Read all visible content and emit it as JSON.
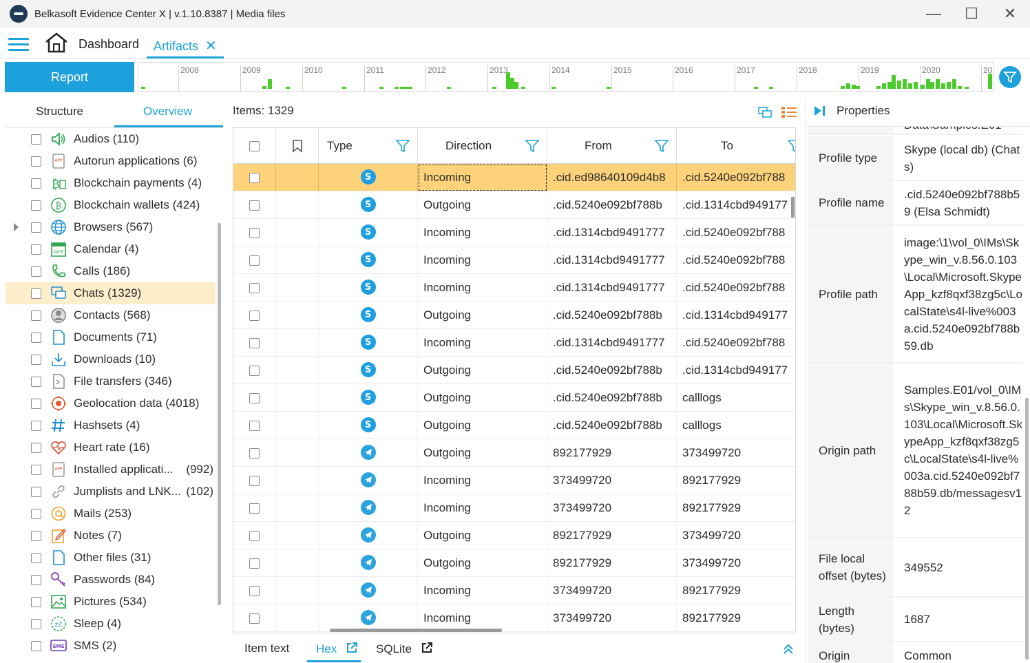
{
  "window": {
    "title": "Belkasoft Evidence Center X | v.1.10.8387 | Media files",
    "minimize": "—",
    "maximize": "☐",
    "close": "✕"
  },
  "menu": {
    "dashboard": "Dashboard",
    "artifacts": "Artifacts",
    "close_tab": "✕"
  },
  "toolbar": {
    "report": "Report"
  },
  "timeline": {
    "years": [
      "2008",
      "2009",
      "2010",
      "2011",
      "2012",
      "2013",
      "2014",
      "2015",
      "2016",
      "2017",
      "2018",
      "2019",
      "2020",
      "20"
    ]
  },
  "left_panel": {
    "tabs": [
      "Structure",
      "Overview"
    ],
    "active_tab": "Overview",
    "items": [
      {
        "label": "Audios (110)",
        "icon": "speaker-icon"
      },
      {
        "label": "Autorun applications (6)",
        "icon": "app-icon"
      },
      {
        "label": "Blockchain payments (4)",
        "icon": "bitcoin-payment-icon"
      },
      {
        "label": "Blockchain wallets (424)",
        "icon": "bitcoin-icon"
      },
      {
        "label": "Browsers (567)",
        "icon": "globe-icon"
      },
      {
        "label": "Calendar (4)",
        "icon": "calendar-icon"
      },
      {
        "label": "Calls (186)",
        "icon": "phone-icon"
      },
      {
        "label": "Chats (1329)",
        "icon": "chat-icon"
      },
      {
        "label": "Contacts (568)",
        "icon": "contact-icon"
      },
      {
        "label": "Documents (71)",
        "icon": "document-icon"
      },
      {
        "label": "Downloads (10)",
        "icon": "download-icon"
      },
      {
        "label": "File transfers (346)",
        "icon": "file-transfer-icon"
      },
      {
        "label": "Geolocation data (4018)",
        "icon": "geolocation-icon"
      },
      {
        "label": "Hashsets (4)",
        "icon": "hash-icon"
      },
      {
        "label": "Heart rate (16)",
        "icon": "heart-icon"
      },
      {
        "label": "Installed applicati...",
        "count": "(992)",
        "icon": "app-icon"
      },
      {
        "label": "Jumplists and LNK...",
        "count": "(102)",
        "icon": "link-icon"
      },
      {
        "label": "Mails (253)",
        "icon": "at-icon"
      },
      {
        "label": "Notes (7)",
        "icon": "note-icon"
      },
      {
        "label": "Other files (31)",
        "icon": "file-icon"
      },
      {
        "label": "Passwords (84)",
        "icon": "key-icon"
      },
      {
        "label": "Pictures (534)",
        "icon": "picture-icon"
      },
      {
        "label": "Sleep (4)",
        "icon": "sleep-icon"
      },
      {
        "label": "SMS (2)",
        "icon": "sms-icon"
      }
    ]
  },
  "center": {
    "items_label": "Items: 1329",
    "columns": [
      "Type",
      "Direction",
      "From",
      "To"
    ],
    "rows": [
      {
        "type": "skype",
        "direction": "Incoming",
        "from": ".cid.ed98640109d4b8",
        "to": ".cid.5240e092bf788"
      },
      {
        "type": "skype",
        "direction": "Outgoing",
        "from": ".cid.5240e092bf788b",
        "to": ".cid.1314cbd949177"
      },
      {
        "type": "skype",
        "direction": "Incoming",
        "from": ".cid.1314cbd9491777",
        "to": ".cid.5240e092bf788"
      },
      {
        "type": "skype",
        "direction": "Incoming",
        "from": ".cid.1314cbd9491777",
        "to": ".cid.5240e092bf788"
      },
      {
        "type": "skype",
        "direction": "Incoming",
        "from": ".cid.1314cbd9491777",
        "to": ".cid.5240e092bf788"
      },
      {
        "type": "skype",
        "direction": "Outgoing",
        "from": ".cid.5240e092bf788b",
        "to": ".cid.1314cbd949177"
      },
      {
        "type": "skype",
        "direction": "Incoming",
        "from": ".cid.1314cbd9491777",
        "to": ".cid.5240e092bf788"
      },
      {
        "type": "skype",
        "direction": "Outgoing",
        "from": ".cid.5240e092bf788b",
        "to": ".cid.1314cbd949177"
      },
      {
        "type": "skype",
        "direction": "Outgoing",
        "from": ".cid.5240e092bf788b",
        "to": "calllogs"
      },
      {
        "type": "skype",
        "direction": "Outgoing",
        "from": ".cid.5240e092bf788b",
        "to": "calllogs"
      },
      {
        "type": "telegram",
        "direction": "Outgoing",
        "from": "892177929",
        "to": "373499720"
      },
      {
        "type": "telegram",
        "direction": "Incoming",
        "from": "373499720",
        "to": "892177929"
      },
      {
        "type": "telegram",
        "direction": "Incoming",
        "from": "373499720",
        "to": "892177929"
      },
      {
        "type": "telegram",
        "direction": "Outgoing",
        "from": "892177929",
        "to": "373499720"
      },
      {
        "type": "telegram",
        "direction": "Outgoing",
        "from": "892177929",
        "to": "373499720"
      },
      {
        "type": "telegram",
        "direction": "Incoming",
        "from": "373499720",
        "to": "892177929"
      },
      {
        "type": "telegram",
        "direction": "Incoming",
        "from": "373499720",
        "to": "892177929"
      }
    ],
    "bottom_tabs": [
      "Item text",
      "Hex",
      "SQLite"
    ],
    "active_bottom_tab": "Hex"
  },
  "properties": {
    "title": "Properties",
    "partial_top": "Data\\Samples.E01",
    "rows": [
      {
        "key": "Profile type",
        "value": "Skype (local db) (Chats)"
      },
      {
        "key": "Profile name",
        "value": ".cid.5240e092bf788b59 (Elsa Schmidt)"
      },
      {
        "key": "Profile path",
        "value": "image:\\1\\vol_0\\IMs\\Skype_win_v.8.56.0.103\\Local\\Microsoft.SkypeApp_kzf8qxf38zg5c\\LocalState\\s4l-live%003a.cid.5240e092bf788b59.db"
      },
      {
        "key": "Origin path",
        "value": "Samples.E01/vol_0\\IMs\\Skype_win_v.8.56.0.103\\Local\\Microsoft.SkypeApp_kzf8qxf38zg5c\\LocalState\\s4l-live%003a.cid.5240e092bf788b59.db/messagesv12"
      },
      {
        "key": "File local offset (bytes)",
        "value": "349552"
      },
      {
        "key": "Length (bytes)",
        "value": "1687"
      },
      {
        "key": "Origin",
        "value": "Common"
      }
    ]
  },
  "colors": {
    "accent": "#1da1dd",
    "selected_row": "#fdd27a",
    "selected_tree": "#fdeecb",
    "timeline_bar": "#4bcb2c",
    "skype": "#1e9fe0",
    "telegram": "#2aa3df"
  }
}
